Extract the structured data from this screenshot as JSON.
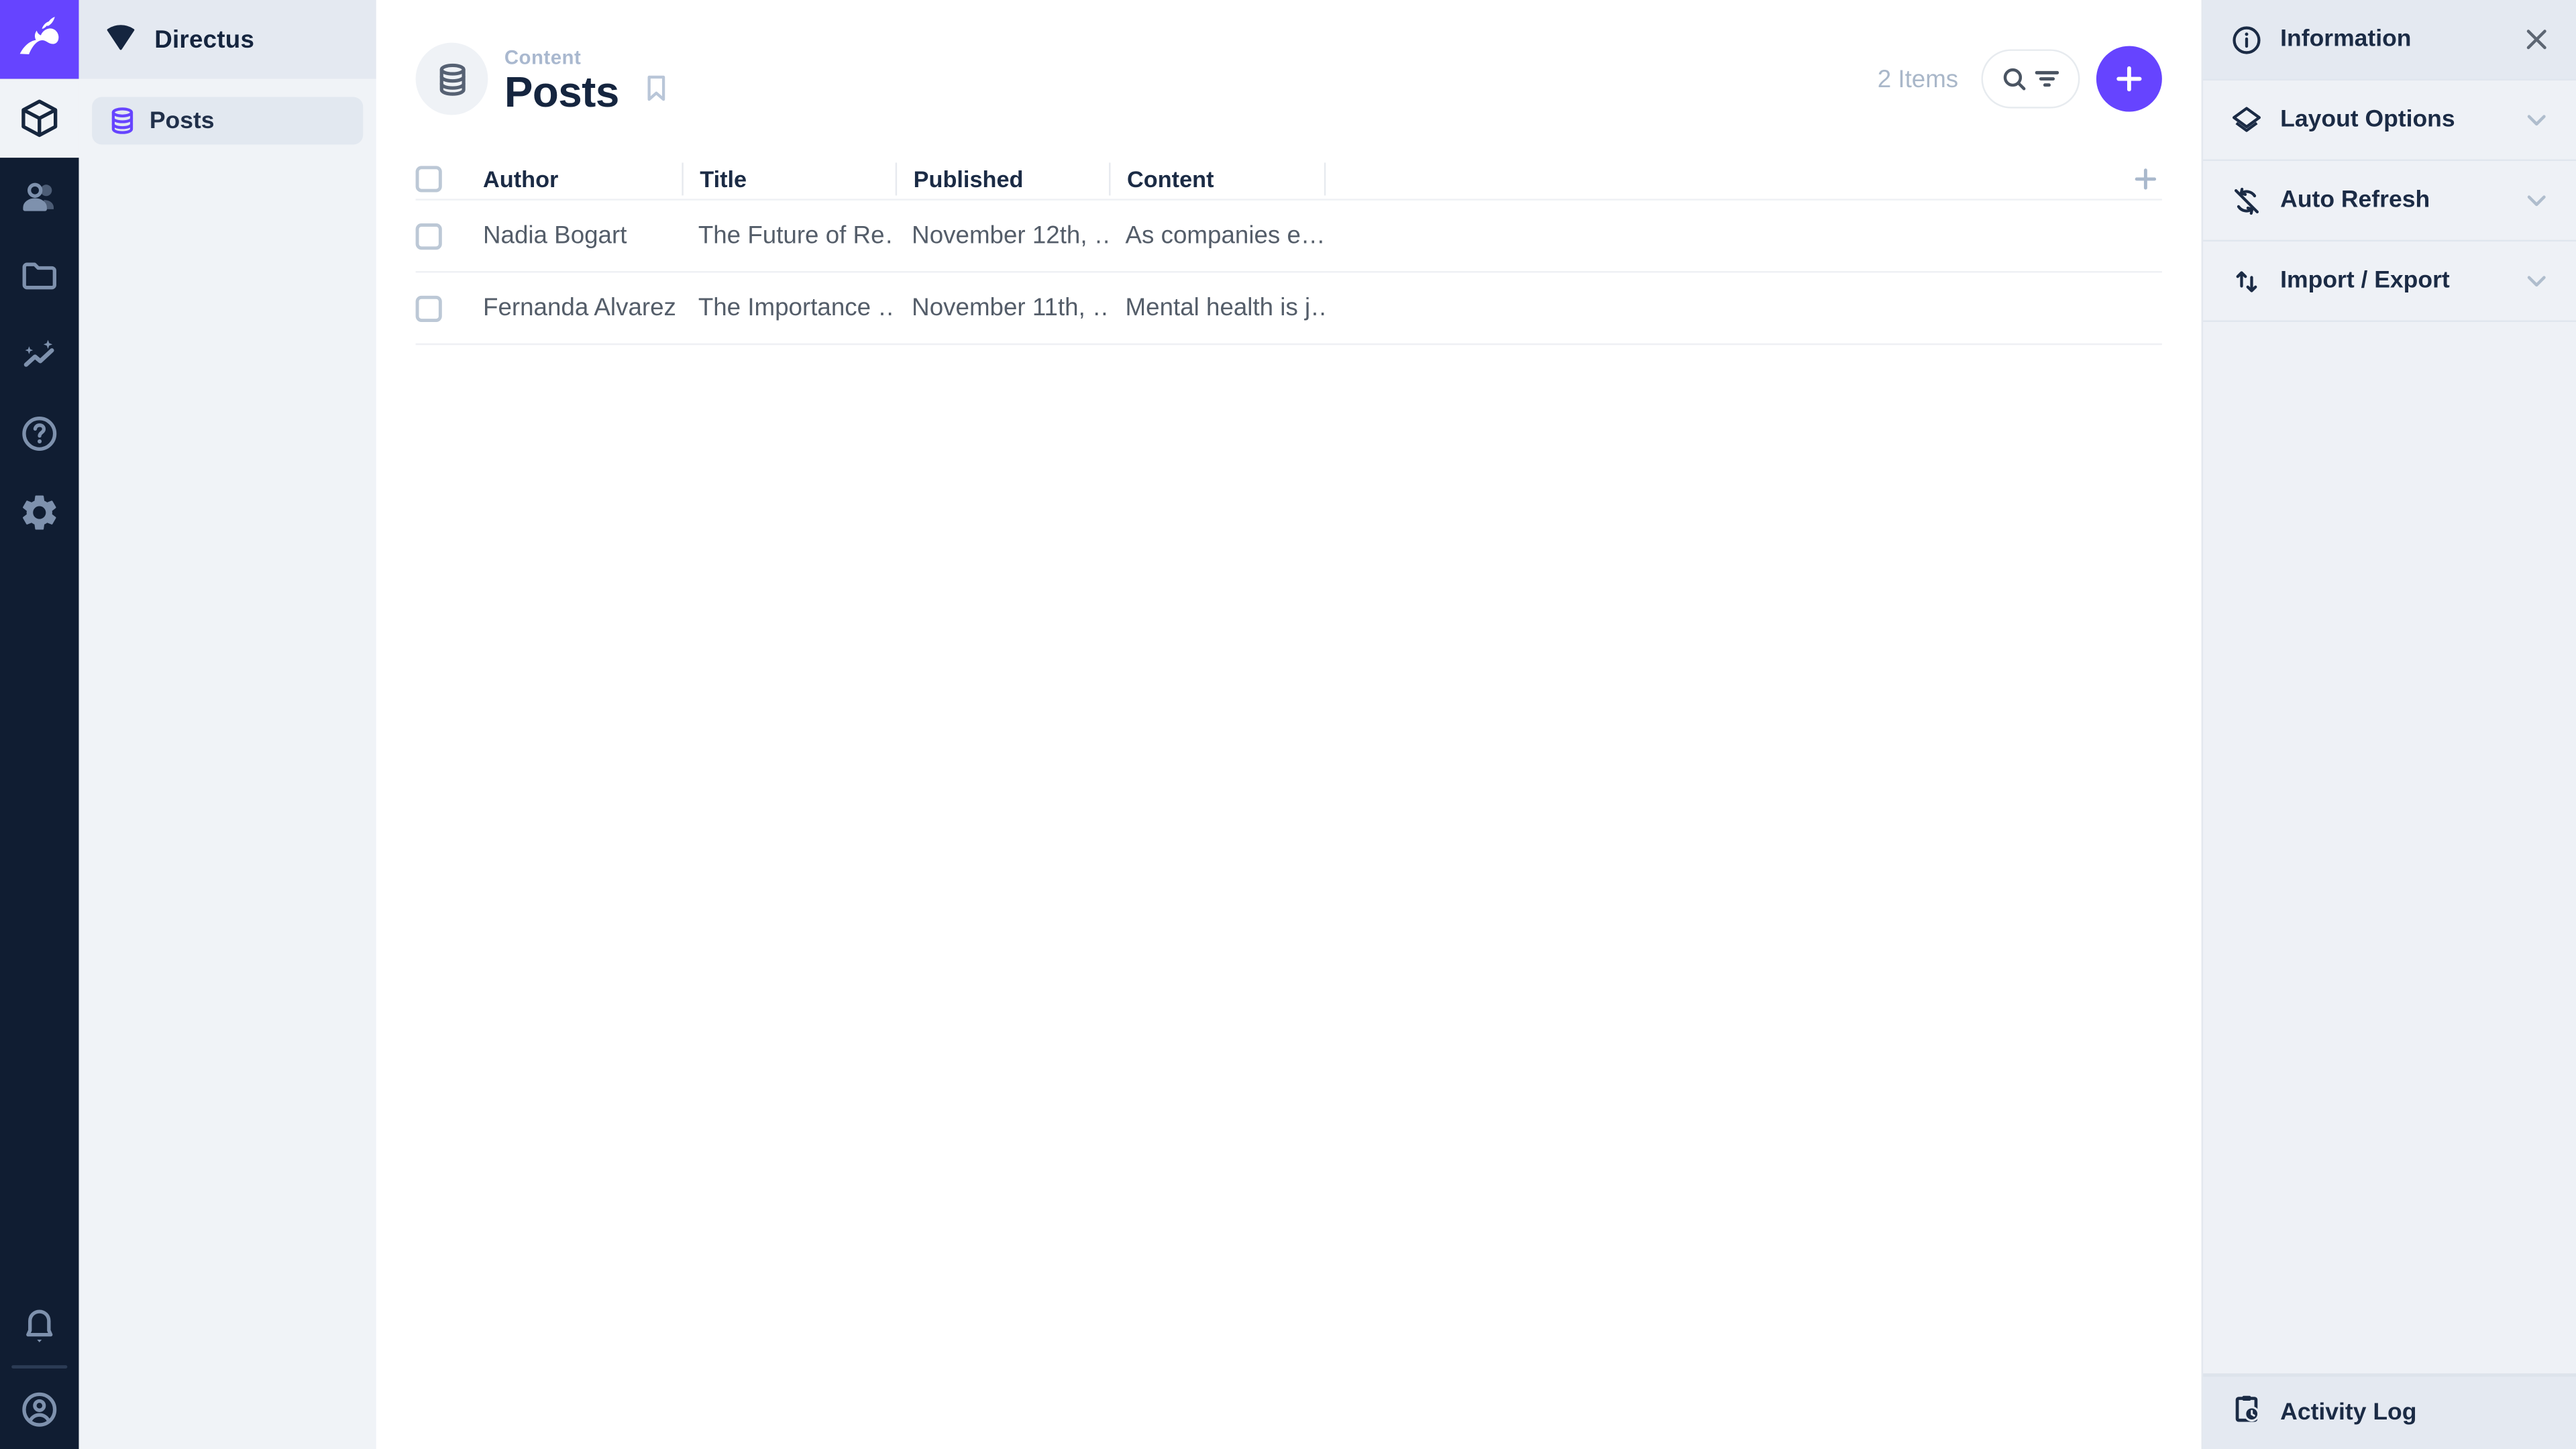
{
  "app": {
    "project_name": "Directus"
  },
  "module_bar": {
    "modules": [
      {
        "name": "content",
        "icon": "cube-icon",
        "active": true
      },
      {
        "name": "users",
        "icon": "people-icon",
        "active": false
      },
      {
        "name": "files",
        "icon": "folder-icon",
        "active": false
      },
      {
        "name": "insights",
        "icon": "insights-icon",
        "active": false
      },
      {
        "name": "docs",
        "icon": "help-icon",
        "active": false
      },
      {
        "name": "settings",
        "icon": "gear-icon",
        "active": false
      }
    ],
    "bottom": [
      {
        "name": "notifications",
        "icon": "bell-icon"
      },
      {
        "name": "account",
        "icon": "account-circle-icon"
      }
    ]
  },
  "sidebar": {
    "items": [
      {
        "label": "Posts",
        "icon": "database-icon",
        "active": true
      }
    ]
  },
  "header": {
    "breadcrumb": "Content",
    "title": "Posts",
    "items_count": "2 Items"
  },
  "table": {
    "columns": [
      "Author",
      "Title",
      "Published",
      "Content"
    ],
    "rows": [
      {
        "author": "Nadia Bogart",
        "title": "The Future of Re…",
        "published": "November 12th, …",
        "content": "As companies e…"
      },
      {
        "author": "Fernanda Alvarez",
        "title": "The Importance …",
        "published": "November 11th, …",
        "content": "Mental health is j…"
      }
    ]
  },
  "right_sidebar": {
    "sections": [
      {
        "label": "Information",
        "icon": "info-icon"
      },
      {
        "label": "Layout Options",
        "icon": "layers-icon"
      },
      {
        "label": "Auto Refresh",
        "icon": "sync-disabled-icon"
      },
      {
        "label": "Import / Export",
        "icon": "swap-vert-icon"
      }
    ],
    "activity_log": "Activity Log"
  },
  "colors": {
    "accent": "#6644FF",
    "module_bar": "#101D32",
    "sidebar_bg": "#F0F3F7",
    "sidebar_band": "#E4E9F1",
    "right_sidebar_bg": "#EEF1F6",
    "heading": "#15253F",
    "muted": "#A9B8CF",
    "row_text": "#545D69"
  }
}
